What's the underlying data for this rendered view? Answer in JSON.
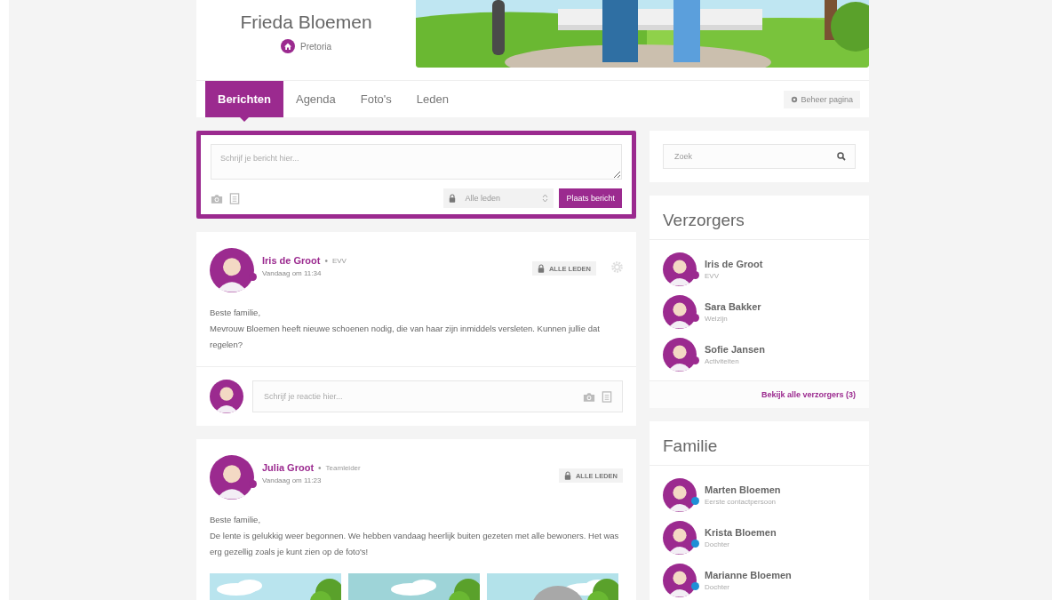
{
  "profile": {
    "name": "Frieda Bloemen",
    "location": "Pretoria"
  },
  "tabs": [
    {
      "label": "Berichten",
      "selected": true
    },
    {
      "label": "Agenda",
      "selected": false
    },
    {
      "label": "Foto's",
      "selected": false
    },
    {
      "label": "Leden",
      "selected": false
    }
  ],
  "manage_button": "Beheer pagina",
  "composer": {
    "placeholder": "Schrijf je bericht hier...",
    "audience": "Alle leden",
    "submit": "Plaats bericht"
  },
  "posts": [
    {
      "kind": "text",
      "author": "Iris de Groot",
      "separator": "•",
      "role": "EVV",
      "time": "Vandaag om 11:34",
      "audience": "ALLE LEDEN",
      "settings": true,
      "color": "#9b2a8f",
      "lines": [
        "Beste familie,",
        "Mevrouw Bloemen heeft nieuwe schoenen nodig, die van haar zijn inmiddels versleten. Kunnen jullie dat regelen?"
      ],
      "comment_placeholder": "Schrijf je reactie hier..."
    },
    {
      "kind": "photos",
      "author": "Julia Groot",
      "separator": "•",
      "role": "Teamleider",
      "time": "Vandaag om 11:23",
      "audience": "ALLE LEDEN",
      "settings": false,
      "color": "#9b2a8f",
      "lines": [
        "Beste familie,",
        "De lente is gelukkig weer begonnen. We hebben vandaag heerlijk buiten gezeten met alle bewoners. Het was erg gezellig zoals je kunt zien op de foto's!"
      ],
      "photos": [
        {
          "kind": "picture"
        },
        {
          "kind": "picture"
        },
        {
          "kind": "picture"
        }
      ]
    }
  ],
  "search": {
    "placeholder": "Zoek"
  },
  "sections": [
    {
      "title": "Verzorgers",
      "people": [
        {
          "name": "Iris de Groot",
          "role": "EVV",
          "color": "#9b2a8f"
        },
        {
          "name": "Sara Bakker",
          "role": "Welzijn",
          "color": "#9b2a8f"
        },
        {
          "name": "Sofie Jansen",
          "role": "Activiteiten",
          "color": "#9b2a8f"
        }
      ],
      "link": "Bekijk alle verzorgers (3)"
    },
    {
      "title": "Familie",
      "people": [
        {
          "name": "Marten Bloemen",
          "role": "Eerste contactpersoon",
          "color": "#1e8fd6"
        },
        {
          "name": "Krista Bloemen",
          "role": "Dochter",
          "color": "#1e8fd6"
        },
        {
          "name": "Marianne Bloemen",
          "role": "Dochter",
          "color": "#1e8fd6"
        }
      ]
    }
  ]
}
